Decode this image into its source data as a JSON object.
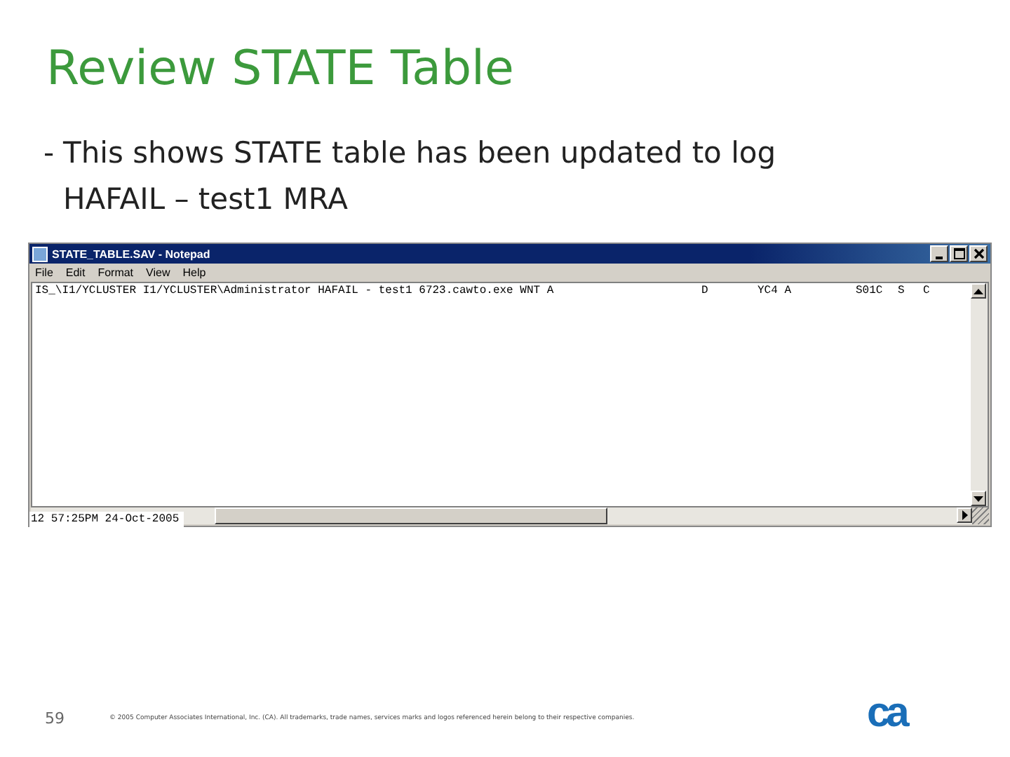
{
  "slide": {
    "title": "Review STATE Table",
    "bullets": [
      {
        "marker": "-",
        "text": "This shows STATE table has been updated to log HAFAIL – test1 MRA"
      }
    ]
  },
  "window": {
    "title": "STATE_TABLE.SAV - Notepad",
    "menu": [
      "File",
      "Edit",
      "Format",
      "View",
      "Help"
    ],
    "lines": [
      {
        "columns": [
          "IS_\\I1/YCLUSTER I1/YCLUSTER\\Administrator HAFAIL - test1 6723.cawto.exe WNT A",
          "D",
          "YC4 A",
          "S01C",
          "S",
          "C"
        ]
      }
    ],
    "overlay_text": "12 57:25PM 24-Oct-2005"
  },
  "footer": {
    "page_number": "59",
    "copyright": "© 2005 Computer Associates International, Inc. (CA). All trademarks, trade names, services marks and logos referenced herein belong to their respective companies.",
    "logo": "ca"
  }
}
